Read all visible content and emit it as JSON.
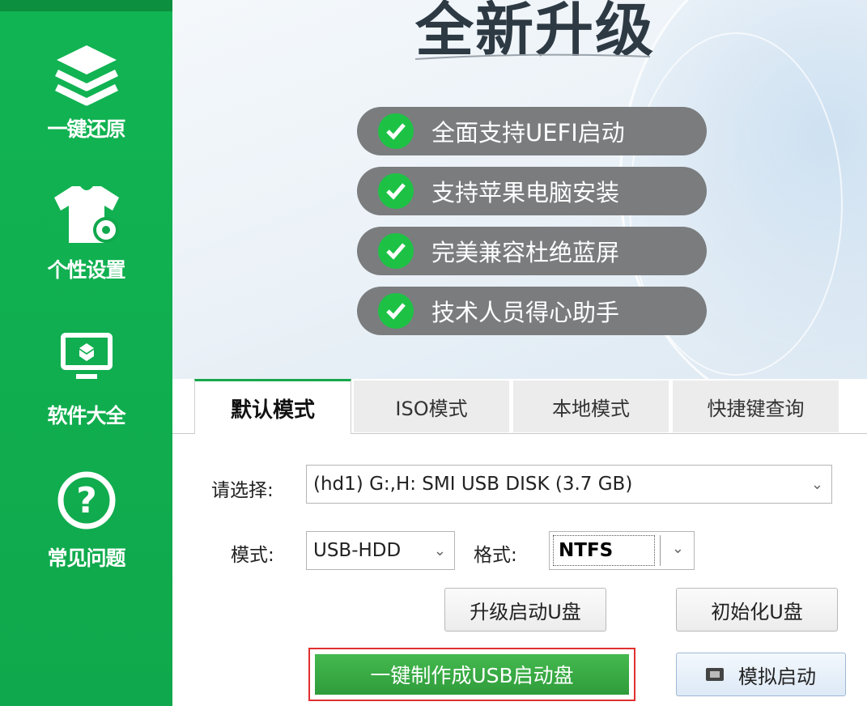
{
  "sidebar": {
    "items": [
      {
        "label": "一键还原",
        "icon": "layers-icon"
      },
      {
        "label": "个性设置",
        "icon": "tshirt-gear-icon"
      },
      {
        "label": "软件大全",
        "icon": "monitor-icon"
      },
      {
        "label": "常见问题",
        "icon": "question-circle-icon"
      }
    ]
  },
  "banner": {
    "headline": "全新升级",
    "features": [
      "全面支持UEFI启动",
      "支持苹果电脑安装",
      "完美兼容杜绝蓝屏",
      "技术人员得心助手"
    ]
  },
  "tabs": [
    "默认模式",
    "ISO模式",
    "本地模式",
    "快捷键查询"
  ],
  "form": {
    "select_label": "请选择:",
    "device_value": "(hd1) G:,H: SMI USB DISK (3.7 GB)",
    "mode_label": "模式:",
    "mode_value": "USB-HDD",
    "format_label": "格式:",
    "format_value": "NTFS"
  },
  "buttons": {
    "upgrade": "升级启动U盘",
    "init": "初始化U盘",
    "make": "一键制作成USB启动盘",
    "simulate": "模拟启动"
  },
  "colors": {
    "sidebar_green": "#11b453",
    "check_green": "#1dc245",
    "highlight_red": "#e03030"
  }
}
